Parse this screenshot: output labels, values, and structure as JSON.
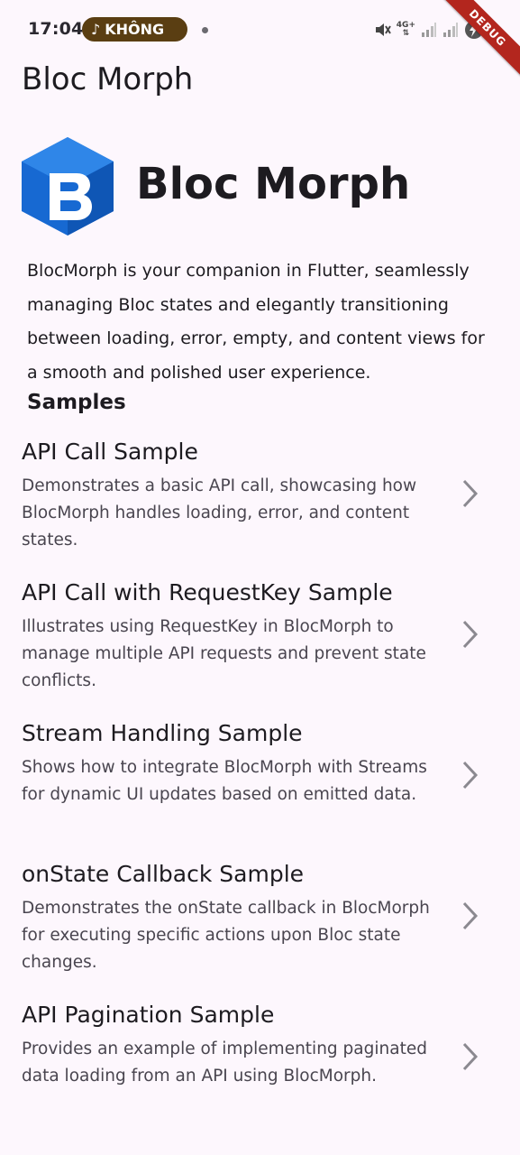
{
  "status_bar": {
    "time": "17:04",
    "pill_label": "KHÔNG",
    "network": "4G+",
    "icons": [
      "music-note-icon",
      "mute-icon",
      "signal-icon",
      "battery-charging-icon"
    ]
  },
  "debug_banner": "DEBUG",
  "app_bar": {
    "title": "Bloc Morph"
  },
  "header": {
    "brand_name": "Bloc Morph",
    "logo_icon": "bloc-cube-logo",
    "brand_color": "#1565c0",
    "description": "BlocMorph is your companion in Flutter, seamlessly managing Bloc states and elegantly transitioning between loading, error, empty, and content views for a smooth and polished user experience."
  },
  "samples": {
    "title": "Samples",
    "items": [
      {
        "title": "API Call Sample",
        "description": "Demonstrates a basic API call, showcasing how BlocMorph handles loading, error, and content states."
      },
      {
        "title": "API Call with RequestKey Sample",
        "description": "Illustrates using RequestKey in BlocMorph to manage multiple API requests and prevent state conflicts."
      },
      {
        "title": "Stream Handling Sample",
        "description": "Shows how to integrate BlocMorph with Streams for dynamic UI updates based on emitted data."
      },
      {
        "title": "onState Callback Sample",
        "description": "Demonstrates the onState callback in BlocMorph for executing specific actions upon Bloc state changes."
      },
      {
        "title": "API Pagination Sample",
        "description": "Provides an example of implementing paginated data loading from an API using BlocMorph."
      }
    ]
  }
}
